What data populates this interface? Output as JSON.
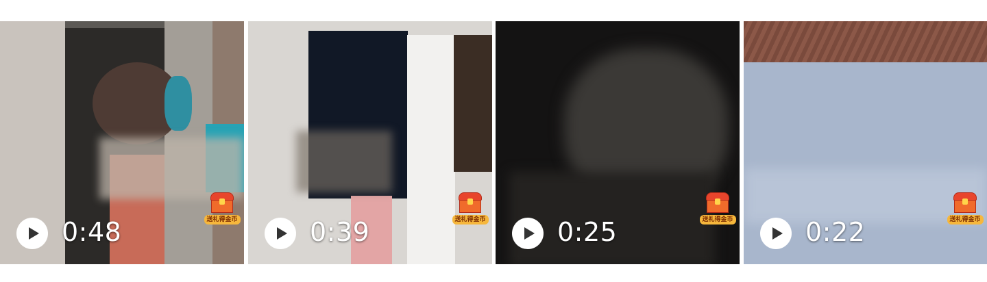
{
  "videos": [
    {
      "duration": "0:48",
      "play_icon": "play-icon",
      "badge_icon": "treasure-chest-icon",
      "badge_label": "送礼得金币"
    },
    {
      "duration": "0:39",
      "play_icon": "play-icon",
      "badge_icon": "treasure-chest-icon",
      "badge_label": "送礼得金币"
    },
    {
      "duration": "0:25",
      "play_icon": "play-icon",
      "badge_icon": "treasure-chest-icon",
      "badge_label": "送礼得金币"
    },
    {
      "duration": "0:22",
      "play_icon": "play-icon",
      "badge_icon": "treasure-chest-icon",
      "badge_label": "送礼得金币"
    }
  ],
  "colors": {
    "overlay_text": "#ffffff",
    "badge_orange": "#f06b2b",
    "badge_gold": "#f6b73c"
  }
}
